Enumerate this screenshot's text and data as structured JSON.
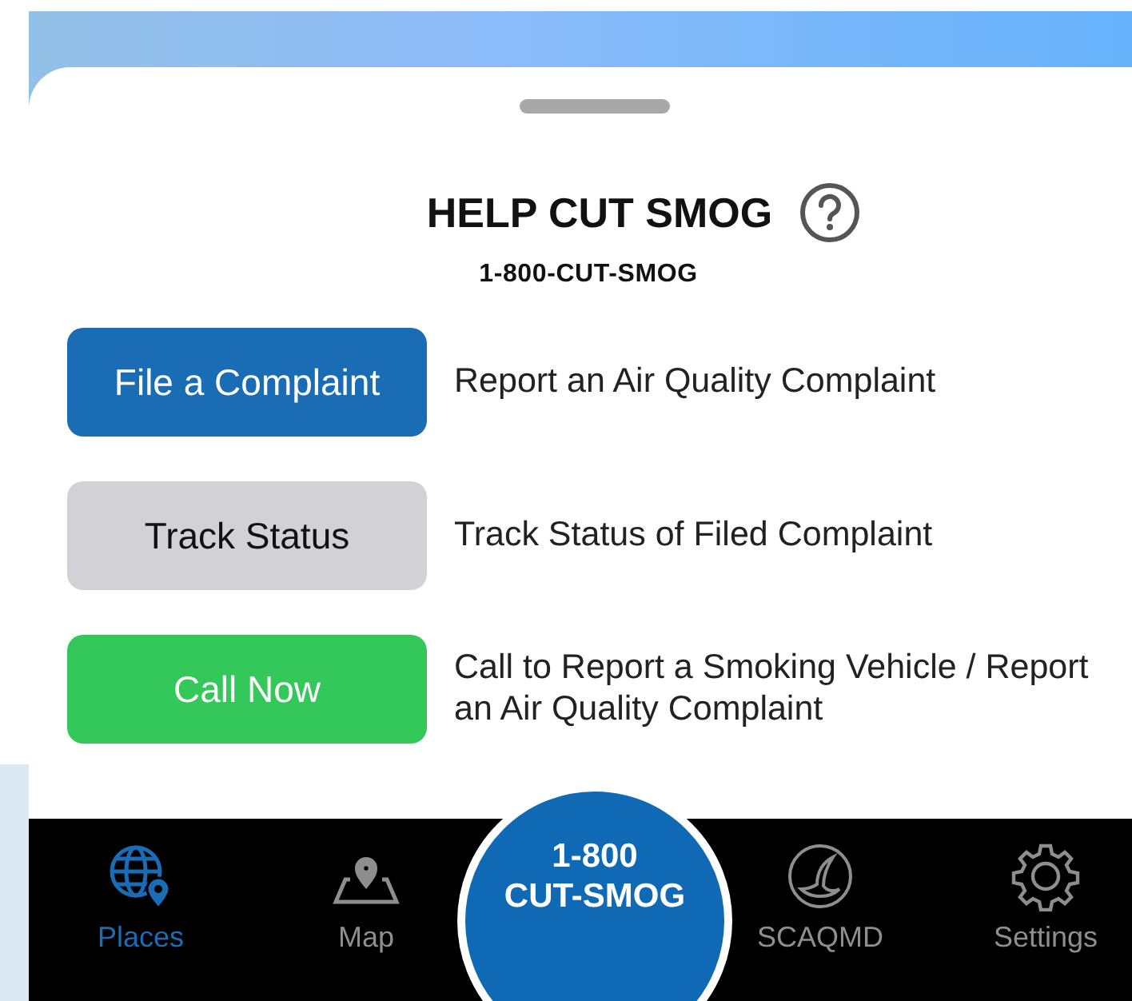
{
  "sheet": {
    "title": "HELP CUT SMOG",
    "phone": "1-800-CUT-SMOG"
  },
  "actions": [
    {
      "label": "File a Complaint",
      "kind": "primary",
      "description": "Report an Air Quality Complaint"
    },
    {
      "label": "Track Status",
      "kind": "secondary",
      "description": "Track Status of Filed Complaint"
    },
    {
      "label": "Call Now",
      "kind": "success",
      "description": "Call to Report a Smoking Vehicle / Report an Air Quality Complaint"
    }
  ],
  "tabs": [
    {
      "label": "Places",
      "kind": "globe",
      "selected": true
    },
    {
      "label": "Map",
      "kind": "map",
      "selected": false
    },
    {
      "label": "SCAQMD",
      "kind": "logo",
      "selected": false
    },
    {
      "label": "Settings",
      "kind": "gear",
      "selected": false
    }
  ],
  "call_button": {
    "lines": [
      "1-800",
      "CUT-SMOG"
    ]
  }
}
